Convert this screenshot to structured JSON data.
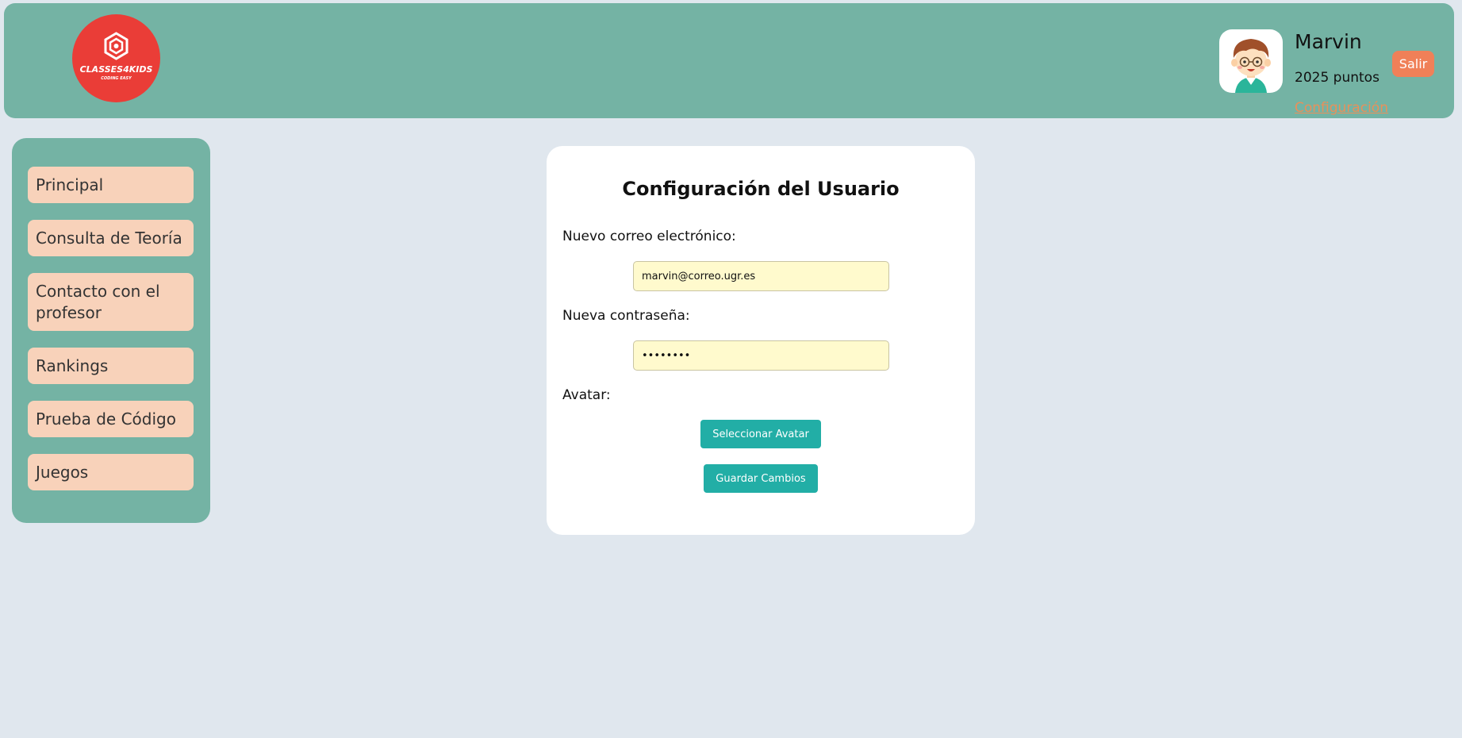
{
  "header": {
    "logo": {
      "name": "CLASSES4KIDS",
      "tagline": "CODING EASY"
    },
    "user": {
      "name": "Marvin",
      "points": "2025 puntos",
      "config_link": "Configuración"
    },
    "logout_label": "Salir"
  },
  "sidebar": {
    "items": [
      {
        "label": "Principal"
      },
      {
        "label": "Consulta de Teoría"
      },
      {
        "label": "Contacto con el profesor"
      },
      {
        "label": "Rankings"
      },
      {
        "label": "Prueba de Código"
      },
      {
        "label": "Juegos"
      }
    ]
  },
  "settings": {
    "title": "Configuración del Usuario",
    "email_label": "Nuevo correo electrónico:",
    "email_value": "marvin@correo.ugr.es",
    "password_label": "Nueva contraseña:",
    "password_value": "password",
    "avatar_label": "Avatar:",
    "select_avatar_label": "Seleccionar Avatar",
    "save_label": "Guardar Cambios"
  },
  "colors": {
    "background": "#e0e7ee",
    "panel": "#74b3a4",
    "logo": "#ea3d37",
    "nav_item": "#f8d2ba",
    "accent": "#22aea6",
    "logout": "#f08058",
    "link": "#e9905a",
    "input_bg": "#fffacd"
  }
}
